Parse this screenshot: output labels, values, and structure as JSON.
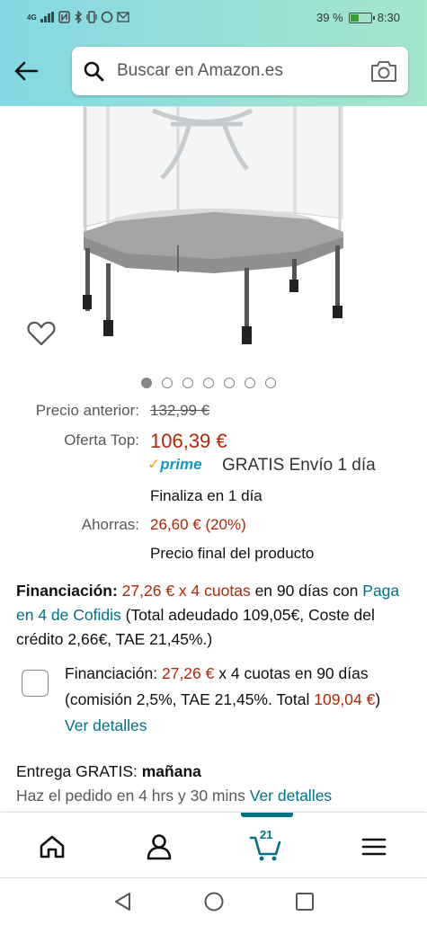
{
  "status_bar": {
    "left_indicators": "4G",
    "battery": "39 %",
    "battery_level": 0.39,
    "time": "8:30"
  },
  "header": {
    "search_placeholder": "Buscar en Amazon.es"
  },
  "carousel": {
    "dot_count": 7,
    "active_index": 0
  },
  "price": {
    "previous_label": "Precio anterior:",
    "previous_value": "132,99 €",
    "offer_label": "Oferta Top:",
    "offer_value": "106,39 €",
    "prime_check": "✓",
    "prime_label": "prime",
    "shipping": "GRATIS Envío 1 día",
    "ends": "Finaliza en 1 día",
    "savings_label": "Ahorras:",
    "savings_value": "26,60 € (20%)",
    "final_note": "Precio final del producto"
  },
  "financing": {
    "label": "Financiación:",
    "amount": "27,26 € x 4 cuotas",
    "term": " en 90 días",
    "with": "con ",
    "provider_link": "Paga en 4 de Cofidis",
    "details": " (Total adeudado 109,05€, Coste del crédito 2,66€, TAE 21,45%.)"
  },
  "financing_option": {
    "label": "Financiación: ",
    "amount": "27,26 €",
    "text": " x 4 cuotas en 90 días (comisión 2,5%, TAE 21,45%. Total ",
    "total": "109,04 €",
    "close": ") ",
    "link": "Ver detalles"
  },
  "delivery": {
    "label": "Entrega GRATIS: ",
    "day": "mañana",
    "order_note": "Haz el pedido en 4 hrs y 30 mins ",
    "link": "Ver detalles"
  },
  "bottom_nav": {
    "cart_count": "21",
    "active": "cart"
  }
}
